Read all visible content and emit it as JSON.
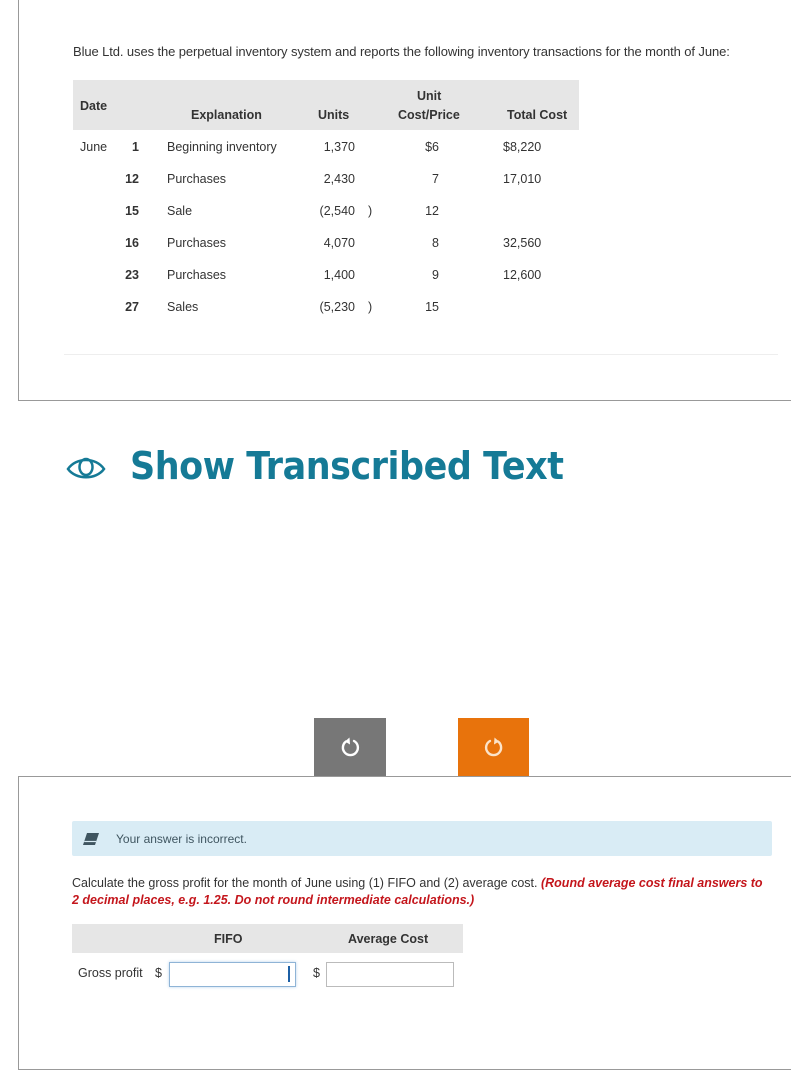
{
  "problem": {
    "intro": "Blue Ltd. uses the perpetual inventory system and reports the following inventory transactions for the month of June:",
    "table": {
      "headers": {
        "date": "Date",
        "explanation": "Explanation",
        "units": "Units",
        "unit_cost_line1": "Unit",
        "unit_cost_line2": "Cost/Price",
        "total_cost": "Total Cost"
      },
      "rows": [
        {
          "month": "June",
          "day": "1",
          "explanation": "Beginning inventory",
          "units": "1,370",
          "unit_cost": "$6",
          "total_cost": "$8,220"
        },
        {
          "month": "",
          "day": "12",
          "explanation": "Purchases",
          "units": "2,430",
          "unit_cost": "7",
          "total_cost": "17,010"
        },
        {
          "month": "",
          "day": "15",
          "explanation": "Sale",
          "units": "(2,540",
          "units_close": ")",
          "unit_cost": "12",
          "total_cost": ""
        },
        {
          "month": "",
          "day": "16",
          "explanation": "Purchases",
          "units": "4,070",
          "unit_cost": "8",
          "total_cost": "32,560"
        },
        {
          "month": "",
          "day": "23",
          "explanation": "Purchases",
          "units": "1,400",
          "unit_cost": "9",
          "total_cost": "12,600"
        },
        {
          "month": "",
          "day": "27",
          "explanation": "Sales",
          "units": "(5,230",
          "units_close": ")",
          "unit_cost": "15",
          "total_cost": ""
        }
      ]
    }
  },
  "transcribed": {
    "label": "Show Transcribed Text",
    "icon": "eye-icon"
  },
  "buttons": {
    "undo_icon": "undo-icon",
    "redo_icon": "redo-icon"
  },
  "feedback": {
    "icon": "eraser-icon",
    "message": "Your answer is incorrect."
  },
  "question": {
    "text": "Calculate the gross profit for the month of June using (1) FIFO and (2) average cost. ",
    "hint": "(Round average cost final answers to 2 decimal places, e.g. 1.25. Do not round intermediate calculations.)"
  },
  "answer": {
    "col_fifo": "FIFO",
    "col_avg": "Average Cost",
    "row_label": "Gross profit",
    "currency": "$",
    "fifo_value": "",
    "avg_value": ""
  },
  "colors": {
    "accent_teal": "#157a96",
    "redo_orange": "#e8730c",
    "undo_gray": "#777777",
    "hint_red": "#c4161c",
    "feedback_bg": "#d9ecf5"
  }
}
